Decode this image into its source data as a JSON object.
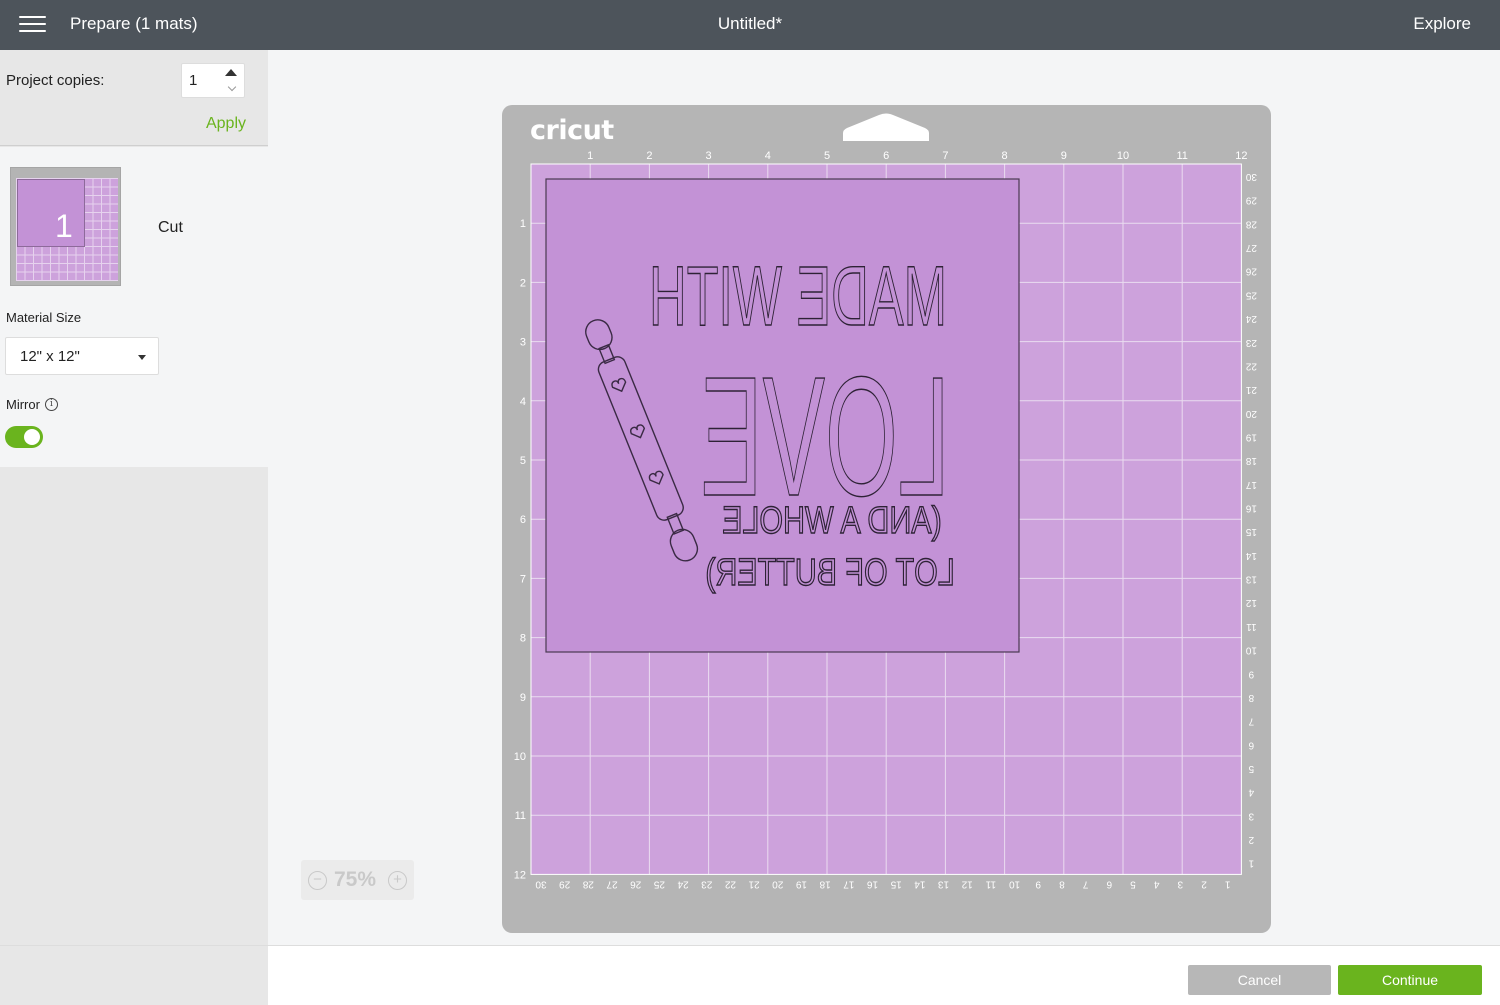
{
  "header": {
    "menu_icon": "hamburger-icon",
    "title": "Prepare (1 mats)",
    "document_title": "Untitled*",
    "explore_label": "Explore"
  },
  "sidebar": {
    "copies_label": "Project copies:",
    "copies_value": "1",
    "apply_label": "Apply",
    "mat": {
      "number": "1",
      "mode_label": "Cut"
    },
    "material_size_label": "Material Size",
    "material_size_value": "12\" x 12\"",
    "mirror_label": "Mirror",
    "mirror_on": true
  },
  "mat": {
    "brand": "cricut",
    "top_ruler": [
      "1",
      "2",
      "3",
      "4",
      "5",
      "6",
      "7",
      "8",
      "9",
      "10",
      "11",
      "12"
    ],
    "left_ruler": [
      "1",
      "2",
      "3",
      "4",
      "5",
      "6",
      "7",
      "8",
      "9",
      "10",
      "11",
      "12"
    ],
    "right_ruler_cm": [
      "30",
      "29",
      "28",
      "27",
      "26",
      "25",
      "24",
      "23",
      "22",
      "21",
      "20",
      "19",
      "18",
      "17",
      "16",
      "15",
      "14",
      "13",
      "12",
      "11",
      "10",
      "9",
      "8",
      "7",
      "6",
      "5",
      "4",
      "3",
      "2",
      "1"
    ],
    "bottom_ruler_cm": [
      "30",
      "29",
      "28",
      "27",
      "26",
      "25",
      "24",
      "23",
      "22",
      "21",
      "20",
      "19",
      "18",
      "17",
      "16",
      "15",
      "14",
      "13",
      "12",
      "11",
      "10",
      "9",
      "8",
      "7",
      "6",
      "5",
      "4",
      "3",
      "2",
      "1"
    ],
    "design_lines": [
      "MADE WITH",
      "LOVE",
      "(AND A WHOLE",
      "LOT OF BUTTER)"
    ],
    "mat_color": "#cda2dc",
    "piece_color": "#c392d6"
  },
  "zoom": {
    "value": "75%",
    "minus": "−",
    "plus": "+"
  },
  "footer": {
    "cancel_label": "Cancel",
    "continue_label": "Continue"
  },
  "colors": {
    "accent": "#6ab41e",
    "topbar": "#4d545b"
  }
}
